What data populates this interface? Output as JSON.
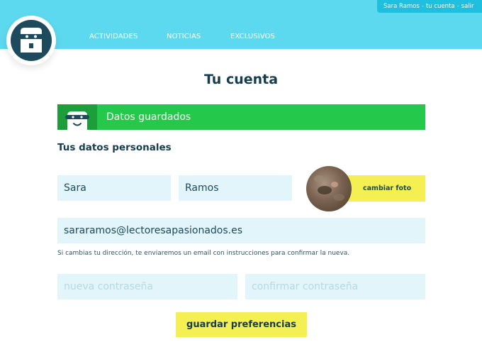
{
  "user_menu": {
    "name": "Sara Ramos",
    "separator": "-",
    "account_link": "tu cuenta",
    "logout_link": "salir"
  },
  "nav": {
    "items": [
      "ACTIVIDADES",
      "NOTICIAS",
      "EXCLUSIVOS"
    ]
  },
  "page": {
    "title": "Tu cuenta"
  },
  "banner": {
    "text": "Datos guardados"
  },
  "personal": {
    "heading": "Tus datos personales",
    "first_name": "Sara",
    "last_name": "Ramos",
    "change_photo_label": "cambiar foto",
    "email": "sararamos@lectoresapasionados.es",
    "email_hint": "Si cambias tu dirección, te enviaremos un email con instrucciones para confirmar la nueva.",
    "new_password_placeholder": "nueva contraseña",
    "confirm_password_placeholder": "confirmar contraseña",
    "save_label": "guardar preferencias"
  },
  "colors": {
    "header_bg": "#5dd9ef",
    "success_green": "#24c84a",
    "accent_yellow": "#f4ef52",
    "field_bg": "#e1f5fb",
    "heading_text": "#163c4f"
  }
}
